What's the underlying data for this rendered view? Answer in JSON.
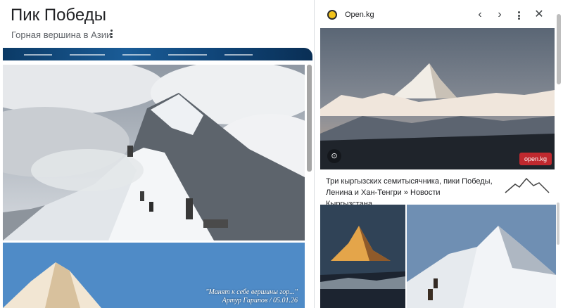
{
  "left_panel": {
    "title": "Пик Победы",
    "subtitle": "Горная вершина в Азии",
    "image_caption_line1": "\"Манят к себе вершины гор...\"",
    "image_caption_line2": "Артур Гарипов / 05.01.26"
  },
  "right_panel": {
    "site_name": "Open.kg",
    "watermark": "open.kg",
    "article_title": "Три кыргызских семитысячника, пики Победы, Ленина и Хан-Тенгри » Новости Кыргызстана,...",
    "icons": {
      "back": "chevron-left-icon",
      "forward": "chevron-right-icon",
      "more": "more-vert-icon",
      "close": "close-icon",
      "lens": "lens-icon"
    }
  },
  "colors": {
    "title": "#202124",
    "subtitle": "#5f6368",
    "watermark_bg": "#c0292f",
    "favicon": "#f2c31b"
  }
}
